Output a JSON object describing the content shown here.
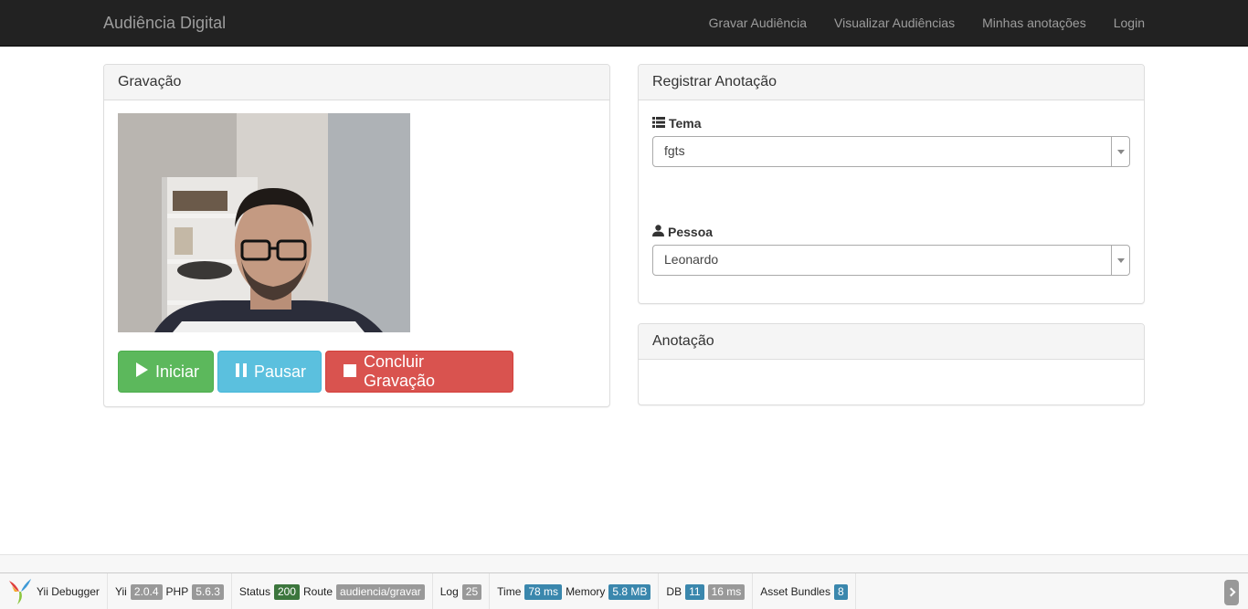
{
  "navbar": {
    "brand": "Audiência Digital",
    "items": [
      {
        "label": "Gravar Audiência"
      },
      {
        "label": "Visualizar Audiências"
      },
      {
        "label": "Minhas anotações"
      },
      {
        "label": "Login"
      }
    ]
  },
  "gravacao": {
    "title": "Gravação",
    "buttons": {
      "start": {
        "label": "Iniciar",
        "icon": "play-icon"
      },
      "pause": {
        "label": "Pausar",
        "icon": "pause-icon"
      },
      "stop": {
        "label": "Concluir Gravação",
        "icon": "stop-icon"
      }
    }
  },
  "registrar": {
    "title": "Registrar Anotação",
    "tema": {
      "label": "Tema",
      "icon": "list-icon",
      "value": "fgts"
    },
    "pessoa": {
      "label": "Pessoa",
      "icon": "user-icon",
      "value": "Leonardo"
    }
  },
  "anotacao": {
    "title": "Anotação"
  },
  "debugger": {
    "title": "Yii Debugger",
    "yii_label": "Yii",
    "yii_version": "2.0.4",
    "php_label": "PHP",
    "php_version": "5.6.3",
    "status_label": "Status",
    "status_value": "200",
    "route_label": "Route",
    "route_value": "audiencia/gravar",
    "log_label": "Log",
    "log_value": "25",
    "time_label": "Time",
    "time_value": "78 ms",
    "memory_label": "Memory",
    "memory_value": "5.8 MB",
    "db_label": "DB",
    "db_count": "11",
    "db_time": "16 ms",
    "assets_label": "Asset Bundles",
    "assets_value": "8"
  },
  "colors": {
    "success": "#5cb85c",
    "info": "#5bc0de",
    "danger": "#d9534f",
    "navbar": "#222222"
  }
}
